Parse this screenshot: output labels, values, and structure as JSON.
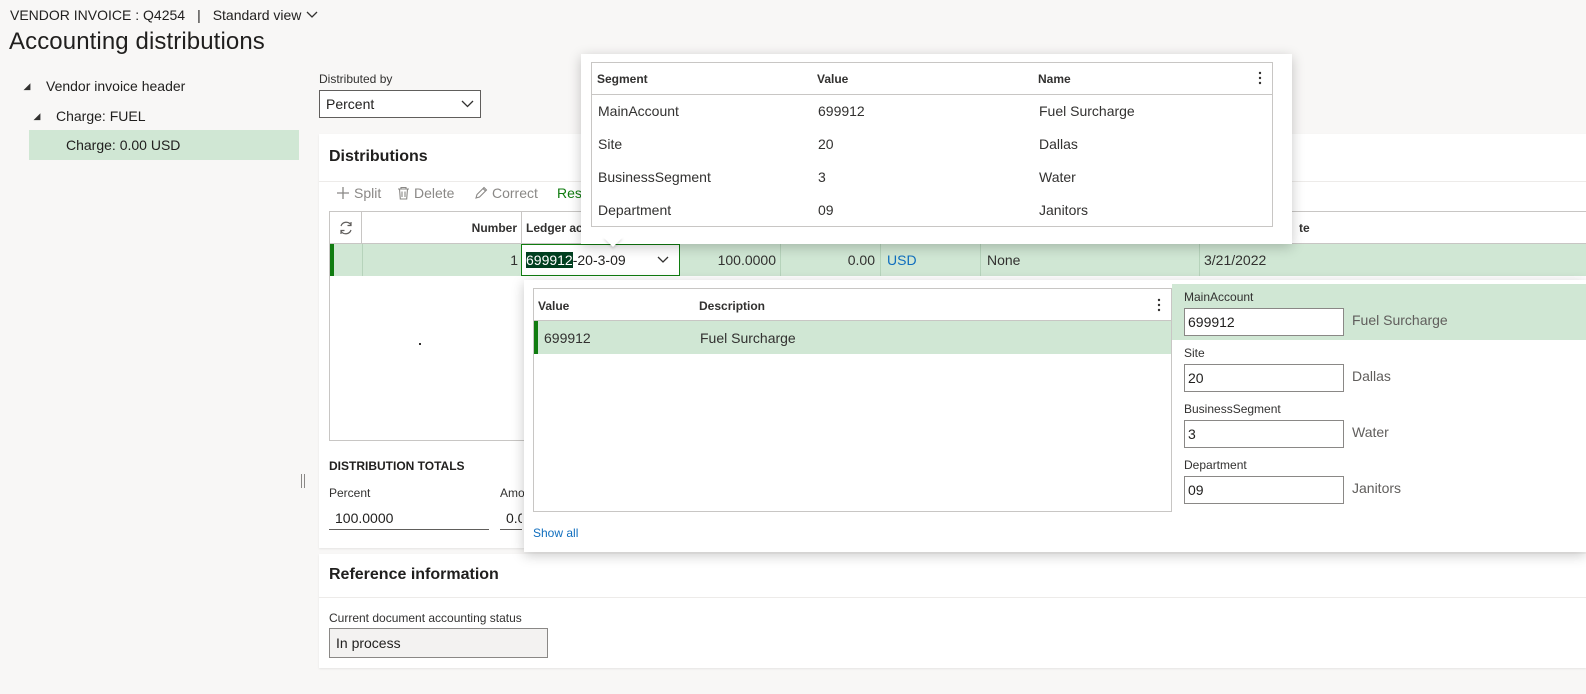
{
  "header": {
    "breadcrumb": "VENDOR INVOICE : Q4254",
    "separator": "|",
    "view_label": "Standard view",
    "title": "Accounting distributions"
  },
  "tree": {
    "items": [
      {
        "label": "Vendor invoice header"
      },
      {
        "label": "Charge: FUEL"
      },
      {
        "label": "Charge: 0.00 USD"
      }
    ]
  },
  "distributed_by": {
    "label": "Distributed by",
    "value": "Percent"
  },
  "distributions": {
    "title": "Distributions",
    "toolbar": {
      "split": "Split",
      "delete": "Delete",
      "correct": "Correct",
      "reset": "Rese"
    },
    "columns": {
      "number": "Number",
      "ledger_account": "Ledger ac",
      "date": "te"
    },
    "row": {
      "number": "1",
      "ledger_selected": "699912",
      "ledger_rest": "-20-3-09",
      "percent": "100.0000",
      "amount": "0.00",
      "currency": "USD",
      "type": "None",
      "date": "3/21/2022"
    }
  },
  "totals": {
    "title": "DISTRIBUTION TOTALS",
    "percent_label": "Percent",
    "percent_value": "100.0000",
    "amount_label": "Amo",
    "amount_value": "0.0"
  },
  "reference": {
    "title": "Reference information",
    "status_label": "Current document accounting status",
    "status_value": "In process"
  },
  "segment_popup": {
    "columns": {
      "segment": "Segment",
      "value": "Value",
      "name": "Name"
    },
    "rows": [
      {
        "segment": "MainAccount",
        "value": "699912",
        "name": "Fuel Surcharge"
      },
      {
        "segment": "Site",
        "value": "20",
        "name": "Dallas"
      },
      {
        "segment": "BusinessSegment",
        "value": "3",
        "name": "Water"
      },
      {
        "segment": "Department",
        "value": "09",
        "name": "Janitors"
      }
    ]
  },
  "lookup_popup": {
    "columns": {
      "value": "Value",
      "description": "Description"
    },
    "rows": [
      {
        "value": "699912",
        "description": "Fuel Surcharge"
      }
    ],
    "show_all": "Show all",
    "segments": [
      {
        "label": "MainAccount",
        "value": "699912",
        "name": "Fuel Surcharge"
      },
      {
        "label": "Site",
        "value": "20",
        "name": "Dallas"
      },
      {
        "label": "BusinessSegment",
        "value": "3",
        "name": "Water"
      },
      {
        "label": "Department",
        "value": "09",
        "name": "Janitors"
      }
    ]
  },
  "colors": {
    "selected_row": "#d0e7d4",
    "accent_green": "#107c10",
    "link_blue": "#106ebe",
    "highlight_text_bg": "#003f1f"
  }
}
